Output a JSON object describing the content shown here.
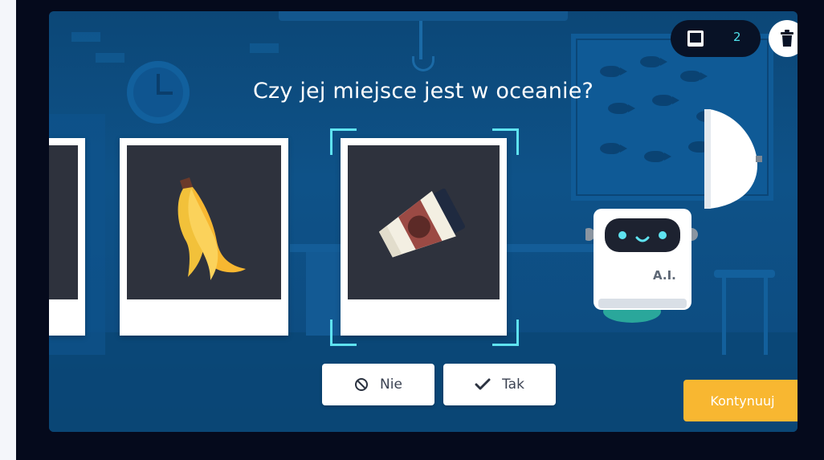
{
  "question": "Czy jej miejsce jest w oceanie?",
  "counter": {
    "icon": "card-stack-icon",
    "value": "2"
  },
  "trash": {
    "icon": "trash-icon"
  },
  "cards": [
    {
      "name": "previous-card",
      "item": ""
    },
    {
      "name": "banana-peel-card",
      "item": "banana-peel"
    },
    {
      "name": "coffee-cup-card",
      "item": "coffee-cup",
      "selected": true
    }
  ],
  "robot": {
    "label": "A.I."
  },
  "buttons": {
    "no": {
      "label": "Nie",
      "icon": "ban-icon"
    },
    "yes": {
      "label": "Tak",
      "icon": "check-icon"
    },
    "continue": {
      "label": "Kontynuuj"
    }
  },
  "colors": {
    "accent": "#5fe3f0",
    "continue": "#f8b731",
    "background": "#0e5288",
    "frame": "#050a1c"
  }
}
